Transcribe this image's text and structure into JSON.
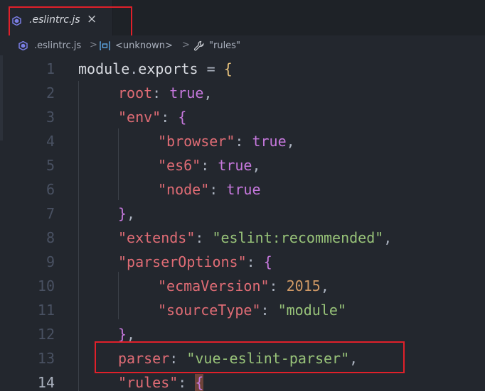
{
  "tab": {
    "label": ".eslintrc.js",
    "close_symbol": "×",
    "icon": "eslint-icon"
  },
  "breadcrumb": {
    "file": ".eslintrc.js",
    "sep1": ">",
    "module": "<unknown>",
    "sep2": ">",
    "property": "\"rules\""
  },
  "editor": {
    "lines": [
      {
        "num": "1"
      },
      {
        "num": "2"
      },
      {
        "num": "3"
      },
      {
        "num": "4"
      },
      {
        "num": "5"
      },
      {
        "num": "6"
      },
      {
        "num": "7"
      },
      {
        "num": "8"
      },
      {
        "num": "9"
      },
      {
        "num": "10"
      },
      {
        "num": "11"
      },
      {
        "num": "12"
      },
      {
        "num": "13"
      },
      {
        "num": "14"
      }
    ],
    "tokens": {
      "l1_a": "module",
      "l1_b": ".",
      "l1_c": "exports",
      "l1_d": " = ",
      "l1_e": "{",
      "l2_a": "root",
      "l2_b": ": ",
      "l2_c": "true",
      "l2_d": ",",
      "l3_a": "\"env\"",
      "l3_b": ": ",
      "l3_c": "{",
      "l4_a": "\"browser\"",
      "l4_b": ": ",
      "l4_c": "true",
      "l4_d": ",",
      "l5_a": "\"es6\"",
      "l5_b": ": ",
      "l5_c": "true",
      "l5_d": ",",
      "l6_a": "\"node\"",
      "l6_b": ": ",
      "l6_c": "true",
      "l7_a": "}",
      "l7_b": ",",
      "l8_a": "\"extends\"",
      "l8_b": ": ",
      "l8_c": "\"eslint:recommended\"",
      "l8_d": ",",
      "l9_a": "\"parserOptions\"",
      "l9_b": ": ",
      "l9_c": "{",
      "l10_a": "\"ecmaVersion\"",
      "l10_b": ": ",
      "l10_c": "2015",
      "l10_d": ",",
      "l11_a": "\"sourceType\"",
      "l11_b": ": ",
      "l11_c": "\"module\"",
      "l12_a": "}",
      "l12_b": ",",
      "l13_a": "parser",
      "l13_b": ": ",
      "l13_c": "\"vue-eslint-parser\"",
      "l13_d": ",",
      "l14_a": "\"rules\"",
      "l14_b": ": ",
      "l14_c": "{"
    }
  },
  "colors": {
    "background": "#23272e",
    "key": "#e06c75",
    "string": "#98c379",
    "boolean": "#c678dd",
    "number": "#d19a66",
    "annotation": "#e0202a"
  }
}
